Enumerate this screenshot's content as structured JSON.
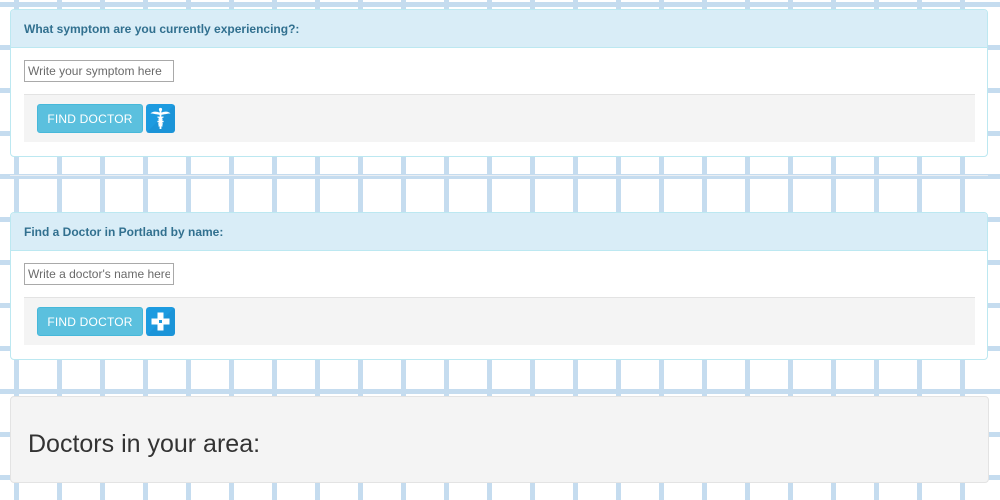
{
  "symptom_search": {
    "heading": "What symptom are you currently experiencing?:",
    "input_placeholder": "Write your symptom here",
    "input_value": "",
    "button_label": "FIND DOCTOR",
    "icon": "caduceus-icon"
  },
  "name_search": {
    "heading": "Find a Doctor in Portland by name:",
    "input_placeholder": "Write a doctor's name here",
    "input_value": "",
    "button_label": "FIND DOCTOR",
    "icon": "medical-cross-icon"
  },
  "area": {
    "title": "Doctors in your area:"
  },
  "colors": {
    "panel_heading_bg": "#d9edf7",
    "panel_heading_text": "#31708f",
    "button_bg": "#5bc0de",
    "icon_tile_bg": "#1d9be0",
    "grid_lines": "#c5dcef"
  }
}
